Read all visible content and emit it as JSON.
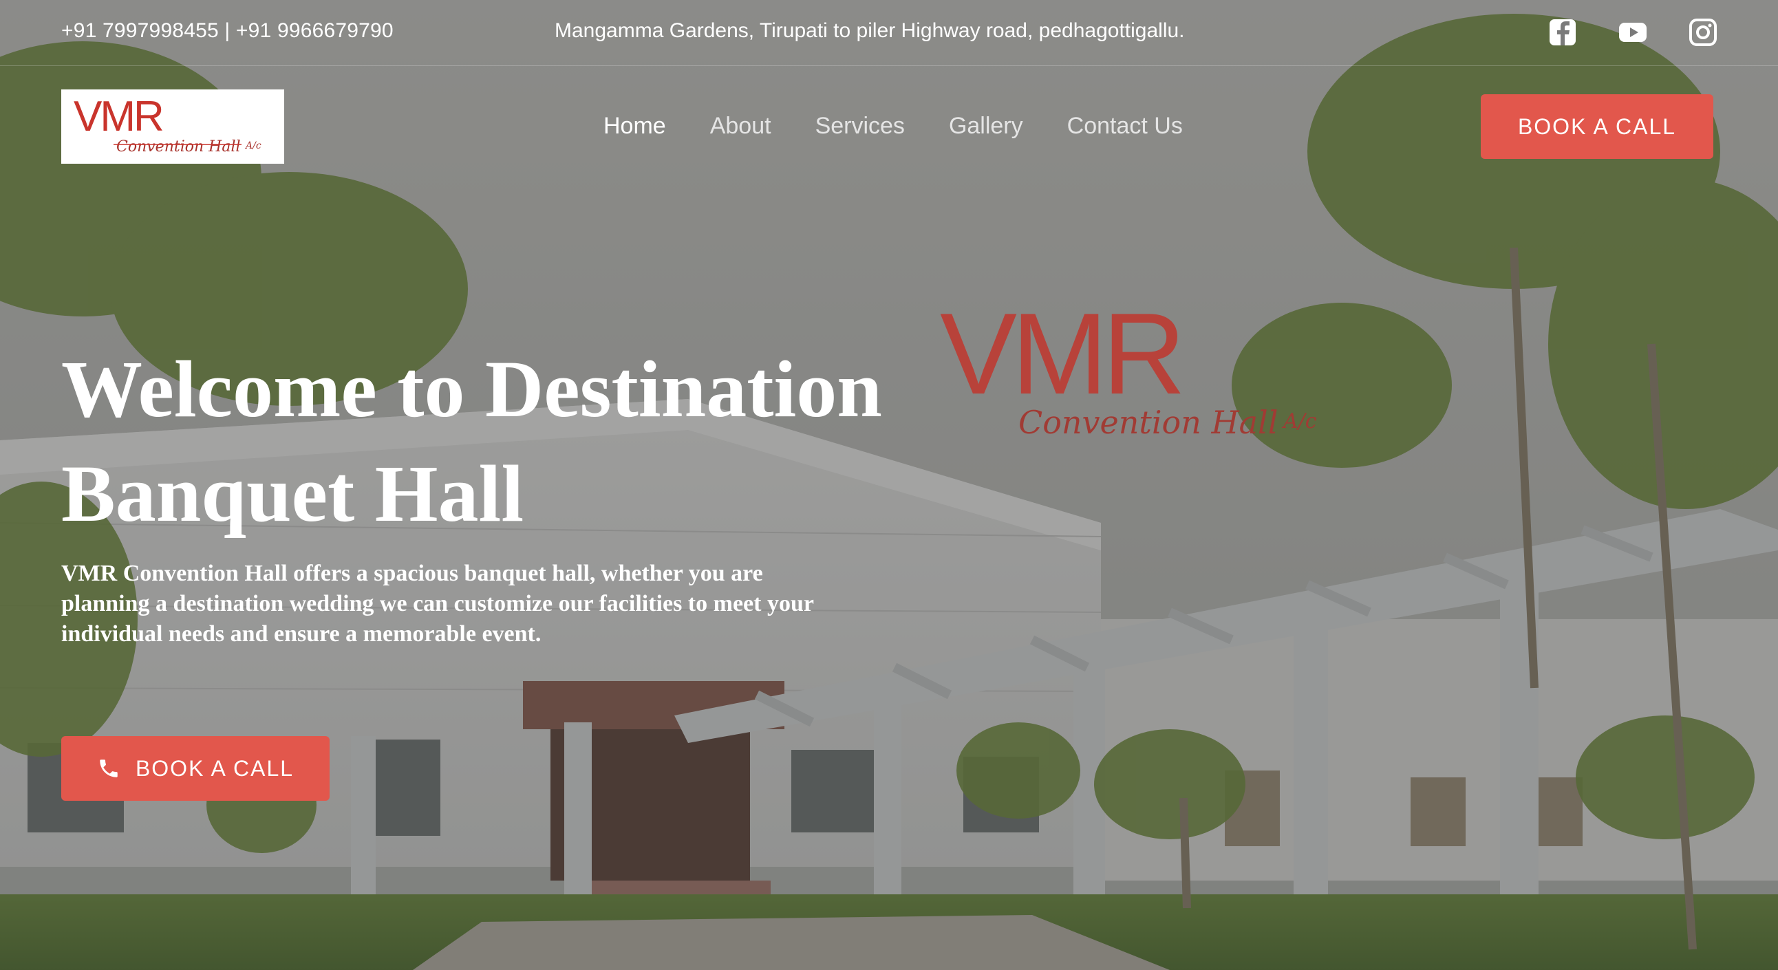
{
  "topbar": {
    "phones": "+91 7997998455 | +91 9966679790",
    "address": "Mangamma Gardens, Tirupati to piler Highway road, pedhagottigallu.",
    "social_icons": [
      "facebook-icon",
      "youtube-icon",
      "instagram-icon"
    ]
  },
  "logo": {
    "main": "VMR",
    "sub": "Convention Hall",
    "mark": "A/c"
  },
  "nav": {
    "items": [
      {
        "label": "Home",
        "active": true
      },
      {
        "label": "About",
        "active": false
      },
      {
        "label": "Services",
        "active": false
      },
      {
        "label": "Gallery",
        "active": false
      },
      {
        "label": "Contact Us",
        "active": false
      }
    ],
    "cta": "BOOK A CALL"
  },
  "hero": {
    "title": "Welcome to Destination Banquet Hall",
    "description": "VMR Convention Hall offers a spacious banquet hall, whether you are planning a destination wedding we can customize our facilities to meet your individual needs and ensure a memorable event.",
    "cta": "BOOK A CALL",
    "cta_icon": "phone-icon"
  },
  "colors": {
    "accent": "#e2574c",
    "logo_red": "#c9342c",
    "overlay": "#373737"
  }
}
